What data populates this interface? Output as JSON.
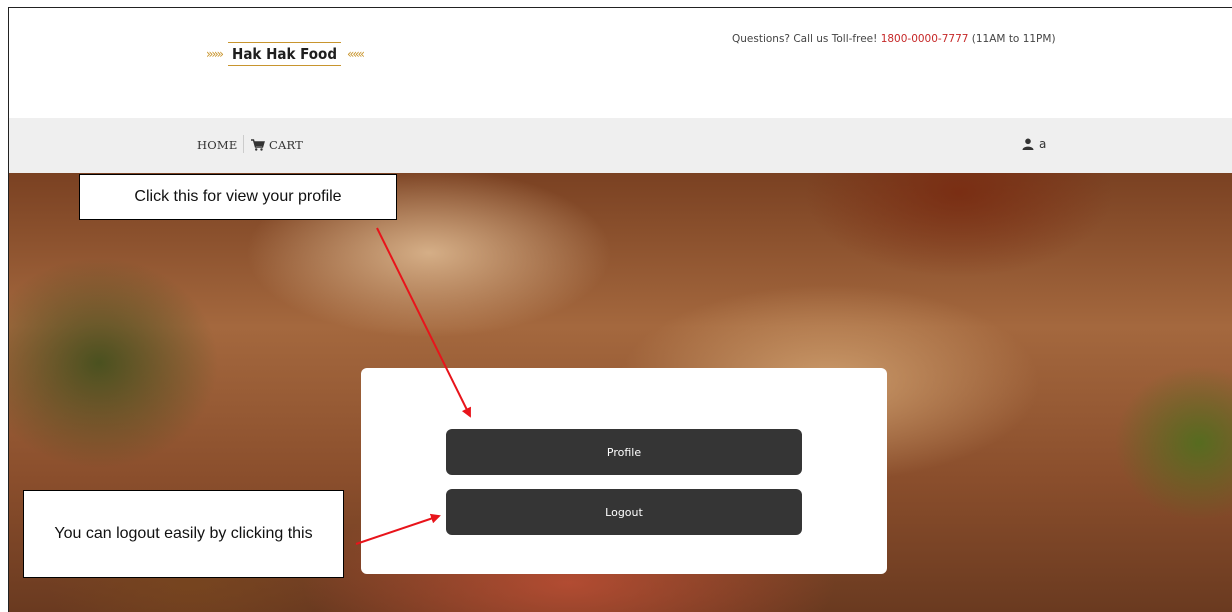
{
  "header": {
    "logo_text": "Hak Hak Food",
    "contact": {
      "prefix": "Questions? Call us Toll-free!",
      "phone": "1800-0000-7777",
      "hours": "(11AM to 11PM)"
    }
  },
  "nav": {
    "home_label": "HOME",
    "cart_label": "CART",
    "cart_icon": "shopping-cart-icon",
    "user_icon": "user-icon",
    "user_name": "a"
  },
  "menu": {
    "profile_label": "Profile",
    "logout_label": "Logout"
  },
  "annotations": {
    "profile_callout": "Click this for view your profile",
    "logout_callout": "You can logout easily by clicking this",
    "arrow_color": "#e8141b"
  },
  "colors": {
    "button_bg": "#353535",
    "phone": "#c62828",
    "nav_bg": "#efefef"
  }
}
